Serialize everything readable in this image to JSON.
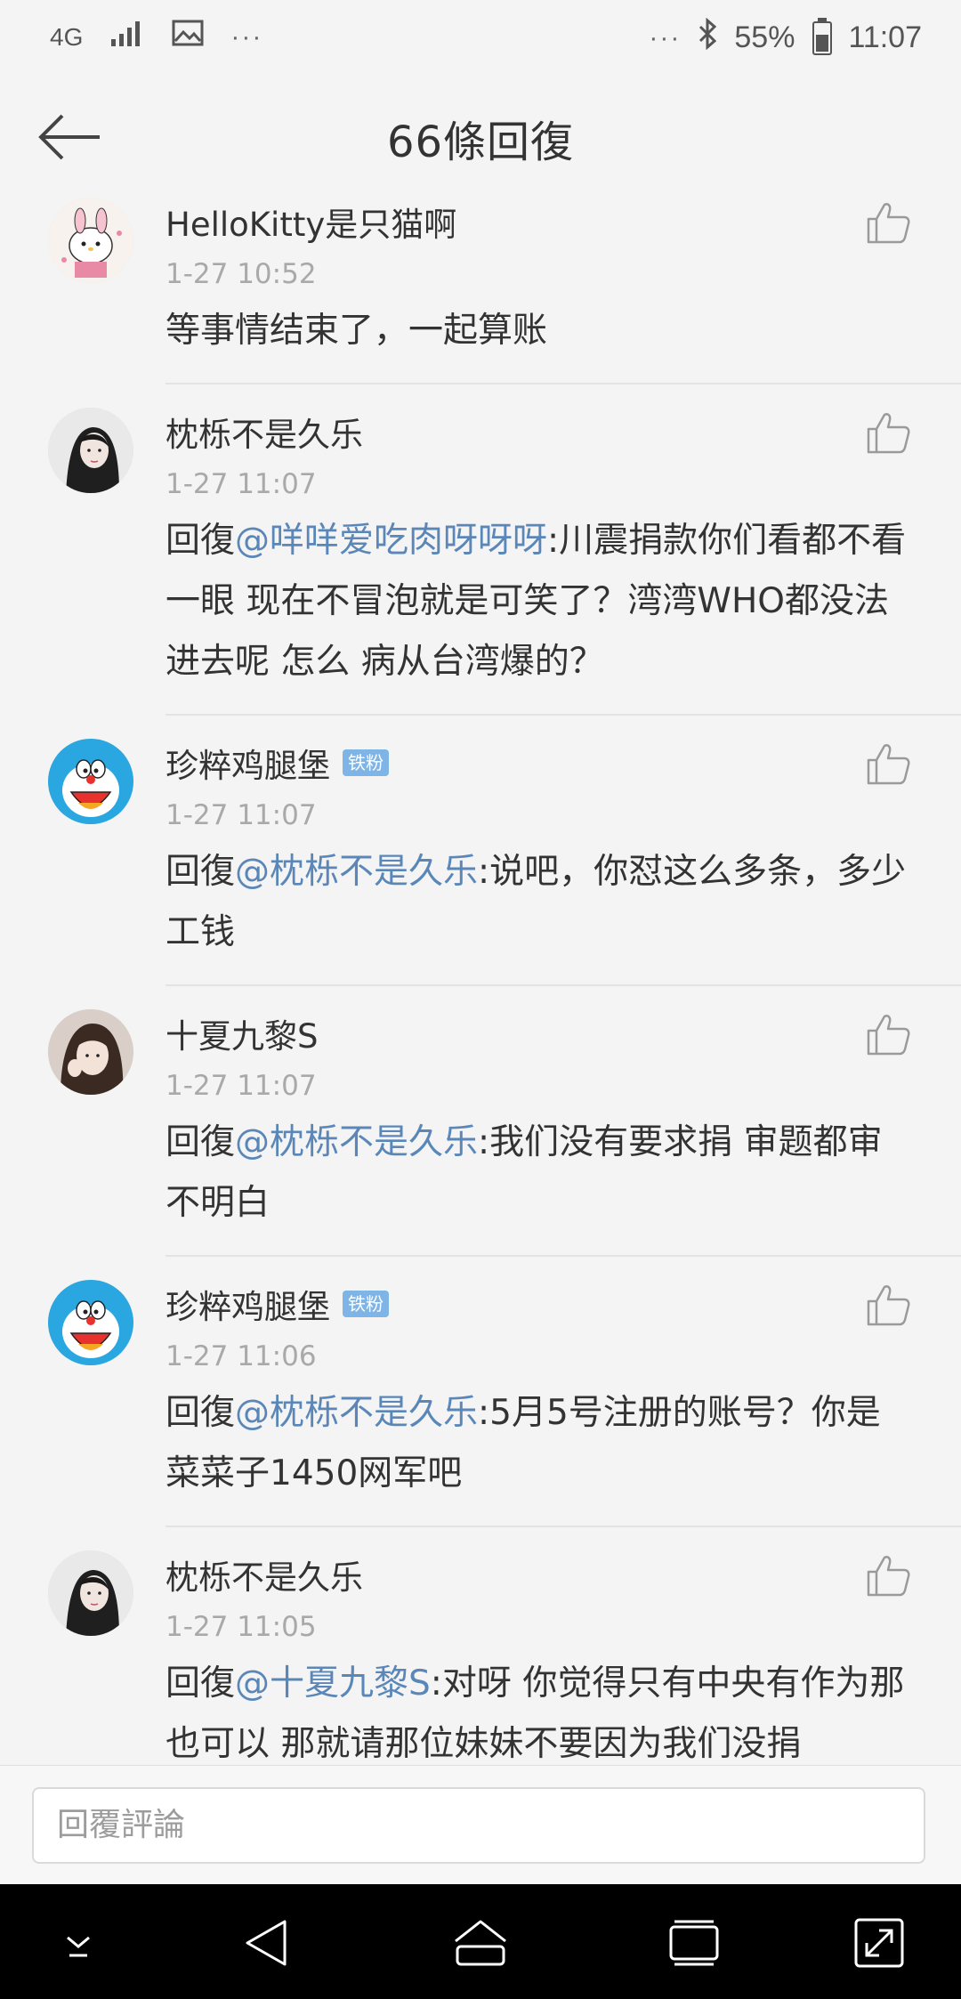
{
  "status_bar": {
    "network": "4G",
    "more": "···",
    "more_right": "···",
    "battery": "55%",
    "battery_level": 0.55,
    "time": "11:07"
  },
  "header": {
    "title": "66條回復"
  },
  "comments": [
    {
      "name": "HelloKitty是只猫啊",
      "badge": "",
      "time": "1-27 10:52",
      "prefix": "",
      "mention": "",
      "text": "等事情结束了，一起算账",
      "avatar": "hellokitty-avatar"
    },
    {
      "name": "枕栎不是久乐",
      "badge": "",
      "time": "1-27 11:07",
      "prefix": "回復",
      "mention": "@咩咩爱吃肉呀呀呀",
      "text": ":川震捐款你们看都不看一眼 现在不冒泡就是可笑了？湾湾WHO都没法进去呢 怎么 病从台湾爆的？",
      "avatar": "girl-avatar"
    },
    {
      "name": "珍粹鸡腿堡",
      "badge": "铁粉",
      "time": "1-27 11:07",
      "prefix": "回復",
      "mention": "@枕栎不是久乐",
      "text": ":说吧，你怼这么多条，多少工钱",
      "avatar": "doraemon-avatar"
    },
    {
      "name": "十夏九黎S",
      "badge": "",
      "time": "1-27 11:07",
      "prefix": "回復",
      "mention": "@枕栎不是久乐",
      "text": ":我们没有要求捐 审题都审不明白",
      "avatar": "photo-avatar"
    },
    {
      "name": "珍粹鸡腿堡",
      "badge": "铁粉",
      "time": "1-27 11:06",
      "prefix": "回復",
      "mention": "@枕栎不是久乐",
      "text": ":5月5号注册的账号？你是菜菜子1450网军吧",
      "avatar": "doraemon-avatar"
    },
    {
      "name": "枕栎不是久乐",
      "badge": "",
      "time": "1-27 11:05",
      "prefix": "回復",
      "mention": "@十夏九黎S",
      "text": ":对呀 你觉得只有中央有作为那也可以 那就请那位妹妹不要因为我们没捐",
      "avatar": "girl-avatar"
    }
  ],
  "reply_bar": {
    "placeholder": "回覆評論"
  },
  "nav_bar": {
    "buttons": [
      "hide-keyboard-icon",
      "back-icon",
      "home-icon",
      "recents-icon",
      "expand-icon"
    ]
  }
}
